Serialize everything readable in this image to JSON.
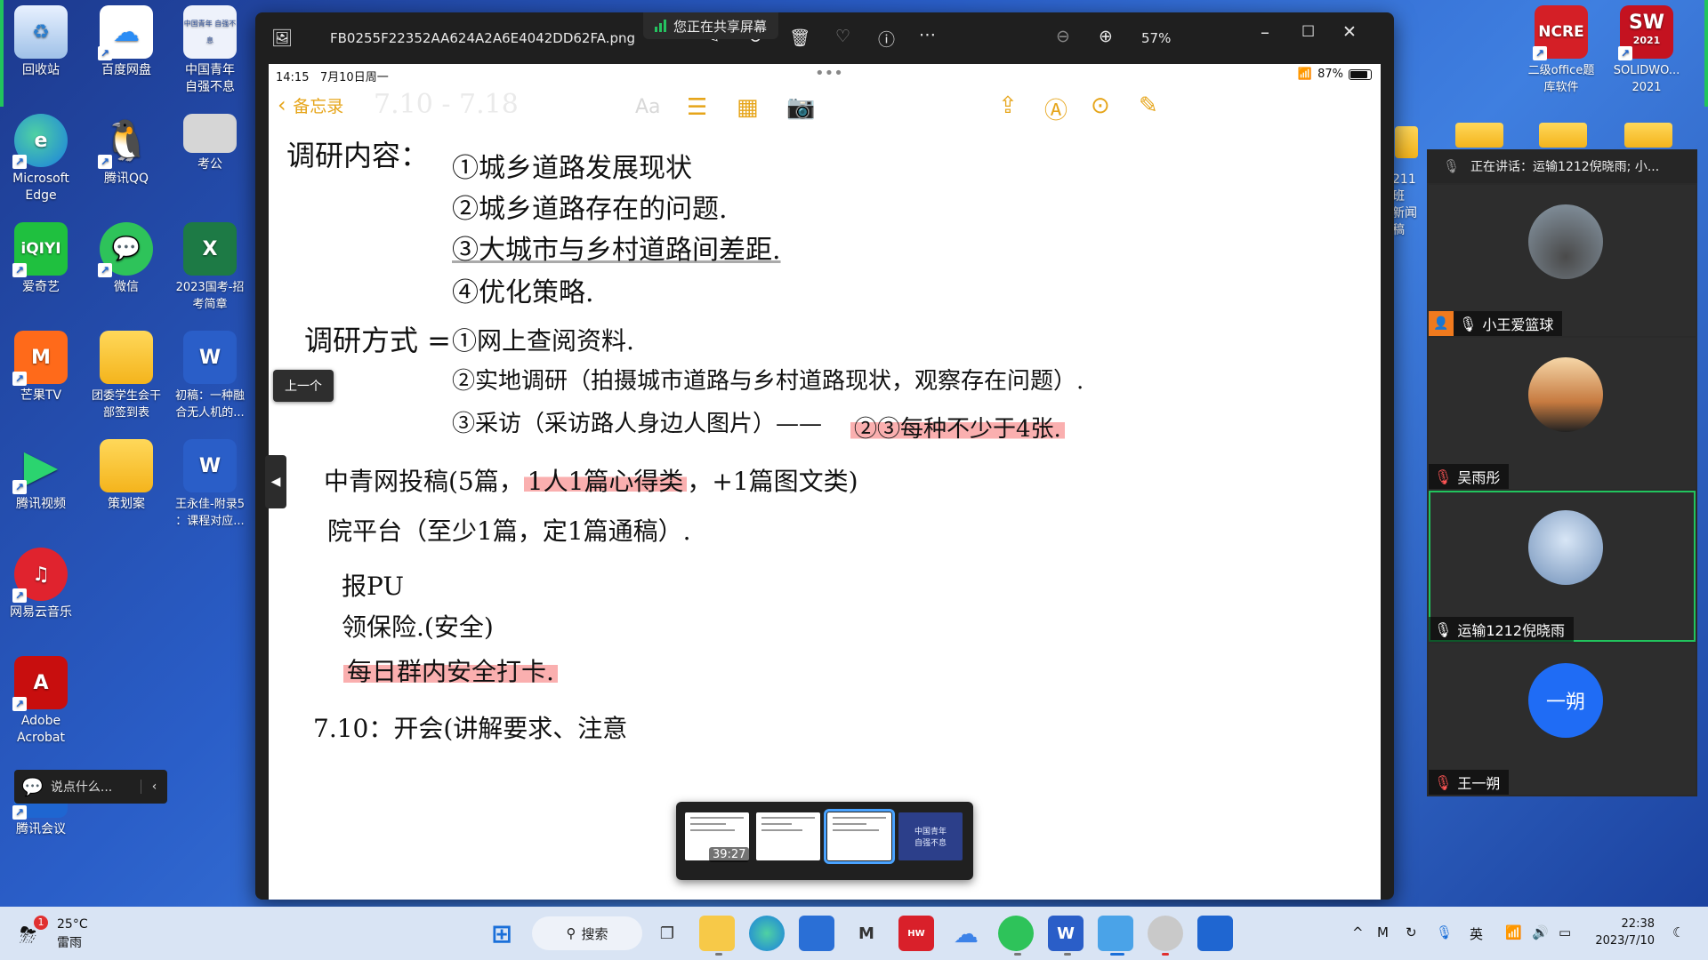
{
  "desktop": {
    "icons": [
      {
        "label": "回收站"
      },
      {
        "label": "百度网盘"
      },
      {
        "label": "中国青年\n自强不息"
      },
      {
        "label": "Microsoft\nEdge"
      },
      {
        "label": "腾讯QQ"
      },
      {
        "label": "考公"
      },
      {
        "label": "爱奇艺"
      },
      {
        "label": "微信"
      },
      {
        "label": "2023国考-招\n考简章"
      },
      {
        "label": "芒果TV"
      },
      {
        "label": "团委学生会干\n部签到表"
      },
      {
        "label": "初稿：一种融\n合无人机的..."
      },
      {
        "label": "腾讯视频"
      },
      {
        "label": "策划案"
      },
      {
        "label": "王永佳-附录5\n：课程对应..."
      },
      {
        "label": "网易云音乐"
      },
      {
        "label": "Adobe\nAcrobat"
      },
      {
        "label": "腾讯会议"
      },
      {
        "label": "二级office题\n库软件"
      },
      {
        "label": "SOLIDWO...\n2021"
      },
      {
        "label": "211班\n新闻稿"
      }
    ],
    "thumb_texts": {
      "cyl": "中国青年 自强不息",
      "iqiyi": "iQIYI",
      "ncre": "NCRE",
      "sw": "SW",
      "sw_year": "2021"
    }
  },
  "viewer": {
    "filename": "FB0255F22352AA624A2A6E4042DD62FA.png",
    "zoom": "57%",
    "share_banner": "您正在共享屏幕",
    "prev_tooltip": "上一个",
    "thumb_time": "39:27",
    "thumb4_text": "中国青年\n自强不息"
  },
  "ipad": {
    "time": "14:15",
    "date": "7月10日周一",
    "battery": "87%",
    "back_label": "备忘录",
    "aa_label": "Aa"
  },
  "notes": {
    "faded": "7.10 - 7.18",
    "research_label": "调研内容：",
    "research_items": [
      "①城乡道路发展现状",
      "②城乡道路存在的问题.",
      "③大城市与乡村道路间差距.",
      "④优化策略."
    ],
    "method_label": "调研方式 =",
    "method_items": [
      "①网上查阅资料.",
      "②实地调研（拍摄城市道路与乡村道路现状，观察存在问题）.",
      "③采访（采访路人身边人图片）——"
    ],
    "method_note": "②③每种不少于4张.",
    "zqw": "中青网投稿(5篇，",
    "zqw_hl": "1人1篇心得类",
    "zqw_end": "，+1篇图文类)",
    "yuan": "院平台（至少1篇，定1篇通稿）.",
    "bao": "报PU",
    "baoxian": "领保险.(安全)",
    "daka": "每日群内安全打卡.",
    "meeting": "7.10：开会(讲解要求、注意"
  },
  "meeting": {
    "speaking": "正在讲话：运输1212倪晓雨; 小...",
    "participants": [
      {
        "name": "小王爱篮球"
      },
      {
        "name": "吴雨彤"
      },
      {
        "name": "运输1212倪晓雨"
      },
      {
        "name": "王一朔",
        "avatar_text": "一朔"
      }
    ]
  },
  "chat": {
    "placeholder": "说点什么..."
  },
  "taskbar": {
    "weather_temp": "25°C",
    "weather_desc": "雷雨",
    "weather_badge": "1",
    "search_label": "搜索",
    "ime": "英",
    "clock_time": "22:38",
    "clock_date": "2023/7/10"
  },
  "colors": {
    "accent_notes": "#e6a51a",
    "highlight": "#f78484",
    "active_speaker": "#21c45d"
  }
}
